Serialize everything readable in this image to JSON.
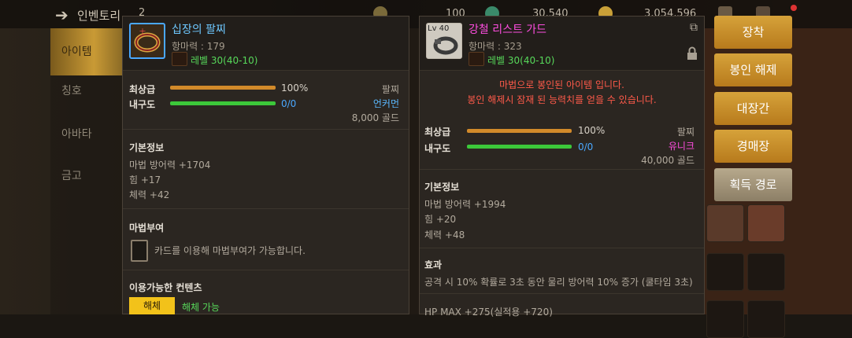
{
  "topbar": {
    "back_icon": "back-arrow-icon",
    "title": "인벤토리",
    "badge": "2",
    "res1": "100",
    "res2": "30,540",
    "res3": "3,054,596"
  },
  "sidebar": {
    "tabs": [
      {
        "label": "아이템"
      },
      {
        "label": "칭호"
      },
      {
        "label": "아바타"
      },
      {
        "label": "금고"
      }
    ]
  },
  "left_item": {
    "name": "십장의 팔찌",
    "name_color": "#6ec8ff",
    "power": "항마력 : 179",
    "level": "레벨 30(40-10)",
    "quality_label": "최상급",
    "quality_pct": "100%",
    "quality_value": 1.0,
    "durability_label": "내구도",
    "durability_value": "0/0",
    "slot": "팔찌",
    "rarity": "언커먼",
    "rarity_color": "#5ab8ff",
    "price": "8,000 골드",
    "basic_title": "기본정보",
    "stats": [
      "마법 방어력 +1704",
      "힘 +17",
      "체력 +42"
    ],
    "enchant_title": "마법부여",
    "enchant_text": "카드를 이용해 마법부여가 가능합니다.",
    "content_title": "이용가능한 컨텐츠",
    "disassemble_btn": "해체",
    "disassemble_status": "해체 가능"
  },
  "right_item": {
    "name": "강철 리스트 가드",
    "name_color": "#ff4de0",
    "lv_badge": "Lv 40",
    "power": "항마력 : 323",
    "level": "레벨 30(40-10)",
    "sealed_line1": "마법으로 봉인된 아이템 입니다.",
    "sealed_line2": "봉인 해제시 잠재 된 능력치를 얻을 수 있습니다.",
    "quality_label": "최상급",
    "quality_pct": "100%",
    "quality_value": 1.0,
    "durability_label": "내구도",
    "durability_value": "0/0",
    "slot": "팔찌",
    "rarity": "유니크",
    "rarity_color": "#ff4de0",
    "price": "40,000 골드",
    "basic_title": "기본정보",
    "stats": [
      "마법 방어력 +1994",
      "힘 +20",
      "체력 +48"
    ],
    "effect_title": "효과",
    "effect_text": "공격 시 10% 확률로 3초 동안 물리 방어력 10% 증가 (쿨타임 3초)",
    "extra_stat": "HP MAX +275(실적용 +720)"
  },
  "actions": [
    "장착",
    "봉인 해제",
    "대장간",
    "경매장",
    "획득 경로"
  ]
}
